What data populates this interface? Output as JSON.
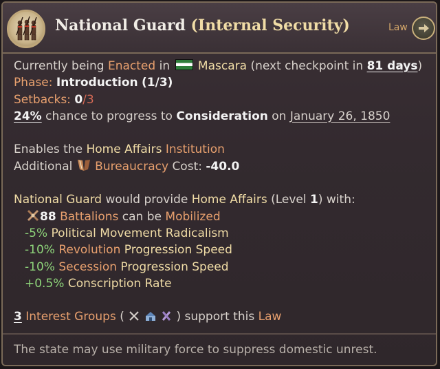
{
  "header": {
    "title_main": "National Guard",
    "title_paren": "(Internal Security)",
    "law_label": "Law"
  },
  "status": {
    "prefix": "Currently being",
    "state": "Enacted",
    "in": "in",
    "country": "Mascara",
    "checkpoint_prefix": "(next checkpoint in",
    "checkpoint_value": "81 days",
    "checkpoint_suffix": ")",
    "phase_label": "Phase:",
    "phase_value": "Introduction",
    "phase_count": "(1/3)",
    "setbacks_label": "Setbacks:",
    "setbacks_current": "0",
    "setbacks_max": "/3",
    "chance_value": "24%",
    "chance_text": "chance to progress to",
    "next_phase": "Consideration",
    "on": "on",
    "date": "January 26, 1850"
  },
  "institution": {
    "enables_prefix": "Enables the",
    "institution_name": "Home Affairs",
    "institution_word": "Institution",
    "additional": "Additional",
    "cost_name": "Bureaucracy",
    "cost_word": "Cost:",
    "cost_value": "-40.0"
  },
  "effects": {
    "law_name": "National Guard",
    "provide_text": "would provide",
    "institution_name": "Home Affairs",
    "level_prefix": "(Level",
    "level_value": "1",
    "level_suffix": ") with:",
    "battalions_value": "88",
    "battalions_word": "Battalions",
    "can_be": "can be",
    "mobilized": "Mobilized",
    "mod1_value": "-5%",
    "mod1_text": "Political Movement Radicalism",
    "mod2_value": "-10%",
    "mod2_hl": "Revolution",
    "mod2_text": "Progression Speed",
    "mod3_value": "-10%",
    "mod3_hl": "Secession",
    "mod3_text": "Progression Speed",
    "mod4_value": "+0.5%",
    "mod4_text": "Conscription Rate"
  },
  "support": {
    "count": "3",
    "groups_text": "Interest Groups",
    "open": "(",
    "close": ")",
    "support_text": "support this",
    "law_word": "Law",
    "group_icons": [
      "crossed-swords-icon",
      "landowners-icon",
      "armed-forces-icon"
    ]
  },
  "footer": {
    "description": "The state may use military force to suppress domestic unrest."
  }
}
